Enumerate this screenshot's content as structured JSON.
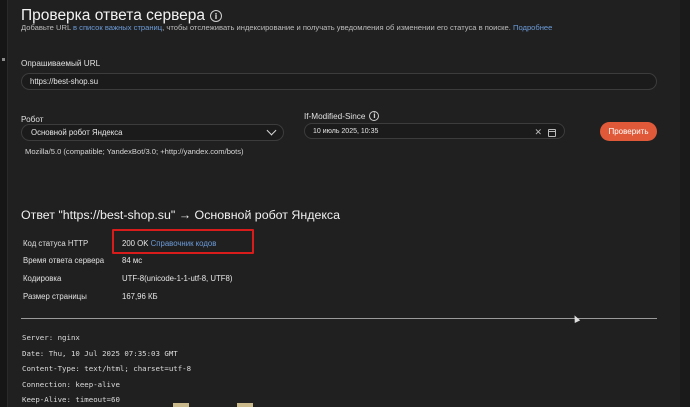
{
  "header": {
    "title": "Проверка ответа сервера",
    "subtitle_pre": "Добавьте URL ",
    "subtitle_link": "в список важных страниц",
    "subtitle_post": ", чтобы отслеживать индексирование и получать уведомления об изменении его статуса в поиске. ",
    "subtitle_more": "Подробнее"
  },
  "form": {
    "url_label": "Опрашиваемый URL",
    "url_value": "https://best-shop.su",
    "robot_label": "Робот",
    "robot_value": "Основной робот Яндекса",
    "ims_label": "If-Modified-Since",
    "ims_value": "10 июль 2025, 10:35",
    "clear_glyph": "✕",
    "check_button": "Проверить",
    "user_agent": "Mozilla/5.0 (compatible; YandexBot/3.0; +http://yandex.com/bots)"
  },
  "result": {
    "title": "Ответ \"https://best-shop.su\" → Основной робот Яндекса",
    "rows": [
      {
        "label": "Код статуса HTTP",
        "value": "200 OK",
        "link": "Справочник кодов"
      },
      {
        "label": "Время ответа сервера",
        "value": "84 мс"
      },
      {
        "label": "Кодировка",
        "value": "UTF-8(unicode-1-1-utf-8, UTF8)"
      },
      {
        "label": "Размер страницы",
        "value": "167,96 КБ"
      }
    ],
    "headers": [
      "Server: nginx",
      "Date: Thu, 10 Jul 2025 07:35:03 GMT",
      "Content-Type: text/html; charset=utf-8",
      "Connection: keep-alive",
      "Keep-Alive: timeout=60"
    ]
  },
  "colors": {
    "accent_button": "#e05a3a",
    "link": "#6b9bd9",
    "highlight_box": "#d81b1b"
  }
}
